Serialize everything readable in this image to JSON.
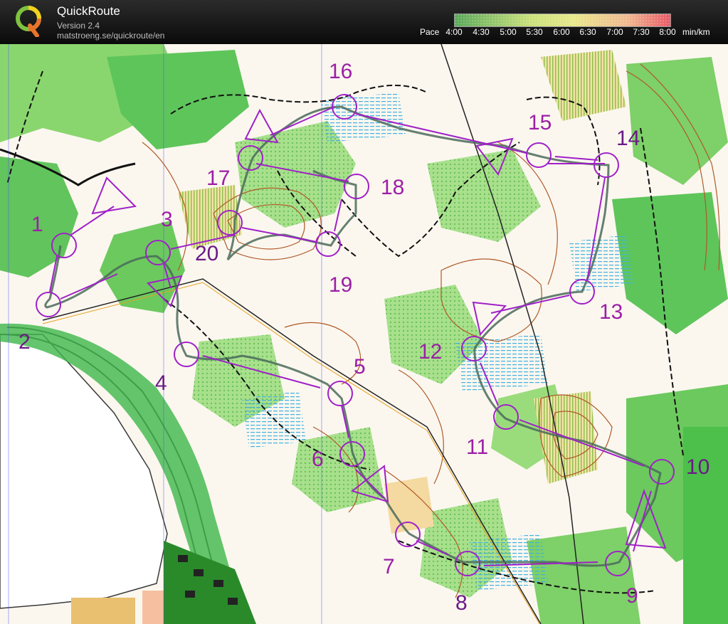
{
  "app": {
    "title": "QuickRoute",
    "version": "Version 2.4",
    "url": "matstroeng.se/quickroute/en"
  },
  "pace_scale": {
    "label": "Pace",
    "ticks": [
      "4:00",
      "4:30",
      "5:00",
      "5:30",
      "6:00",
      "6:30",
      "7:00",
      "7:30",
      "8:00"
    ],
    "unit": "min/km",
    "colors": {
      "fast": "#4fae52",
      "mid": "#e8e46a",
      "slow": "#e84f5a"
    }
  },
  "map": {
    "colors": {
      "course": "#a020c8",
      "forest_green": "#4cc04a",
      "light_green": "#a8e08c",
      "contour": "#b05a28",
      "route": "#4a6a5a",
      "marsh": "#40b0e0"
    },
    "controls": [
      {
        "label": "1"
      },
      {
        "label": "2"
      },
      {
        "label": "3"
      },
      {
        "label": "4"
      },
      {
        "label": "5"
      },
      {
        "label": "6"
      },
      {
        "label": "7"
      },
      {
        "label": "8"
      },
      {
        "label": "9"
      },
      {
        "label": "10"
      },
      {
        "label": "11"
      },
      {
        "label": "12"
      },
      {
        "label": "13"
      },
      {
        "label": "14"
      },
      {
        "label": "15"
      },
      {
        "label": "16"
      },
      {
        "label": "17"
      },
      {
        "label": "18"
      },
      {
        "label": "19"
      },
      {
        "label": "20"
      }
    ]
  }
}
